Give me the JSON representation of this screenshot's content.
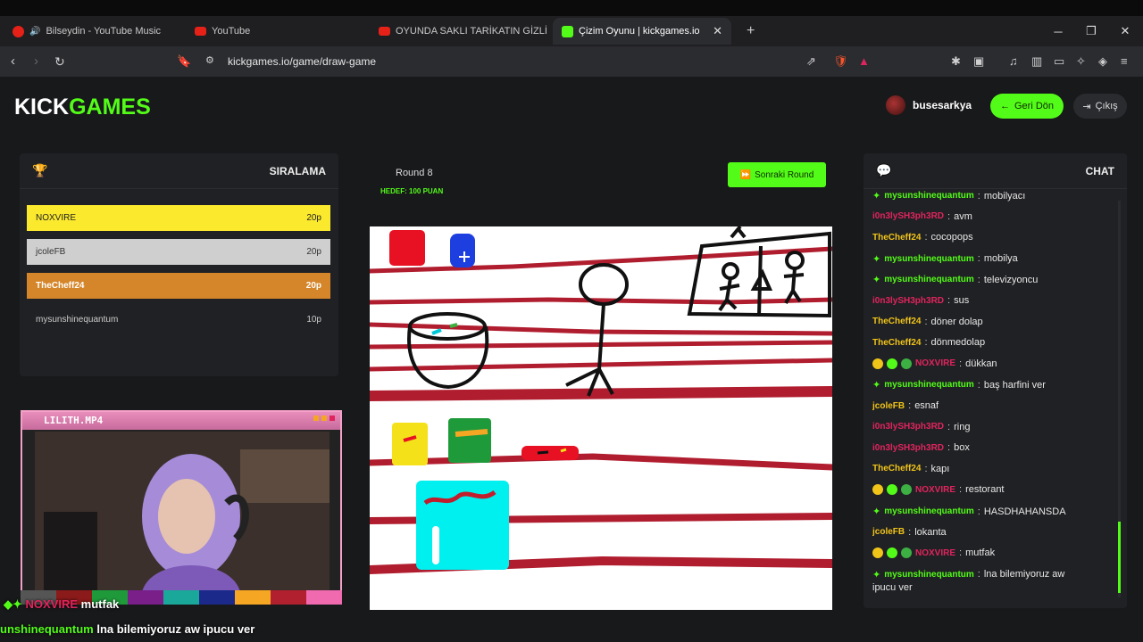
{
  "browser": {
    "tabs": [
      {
        "label": "Bilseydin - YouTube Music",
        "icon": "youtube-music-icon"
      },
      {
        "label": "YouTube",
        "icon": "youtube-icon"
      },
      {
        "label": "OYUNDA SAKLI TARİKATIN GİZLİ SIRI",
        "icon": "youtube-icon"
      },
      {
        "label": "Çizim Oyunu | kickgames.io",
        "icon": "kickgames-icon",
        "active": true
      }
    ],
    "url": "kickgames.io/game/draw-game"
  },
  "site": {
    "logo_part1": "KICK",
    "logo_part2": "GAMES",
    "username": "busesarkya",
    "back_label": "Geri Dön",
    "logout_label": "Çıkış"
  },
  "ranking": {
    "title": "SIRALAMA",
    "rows": [
      {
        "name": "NOXVIRE",
        "score": "20p"
      },
      {
        "name": "jcoleFB",
        "score": "20p"
      },
      {
        "name": "TheCheff24",
        "score": "20p"
      },
      {
        "name": "mysunshinequantum",
        "score": "10p"
      }
    ]
  },
  "game": {
    "round": "Round 8",
    "target": "HEDEF: 100 PUAN",
    "next_round_label": "Sonraki Round"
  },
  "chat": {
    "title": "CHAT",
    "messages": [
      {
        "user": "mysunshinequantum",
        "text": "mobilyacı",
        "color": "#53fc18",
        "badge": "diamond"
      },
      {
        "user": "i0n3lySH3ph3RD",
        "text": "avm",
        "color": "#e0245e",
        "badge": ""
      },
      {
        "user": "TheCheff24",
        "text": "cocopops",
        "color": "#f0c419",
        "badge": ""
      },
      {
        "user": "mysunshinequantum",
        "text": "mobilya",
        "color": "#53fc18",
        "badge": "diamond"
      },
      {
        "user": "mysunshinequantum",
        "text": "televizyoncu",
        "color": "#53fc18",
        "badge": "diamond"
      },
      {
        "user": "i0n3lySH3ph3RD",
        "text": "sus",
        "color": "#e0245e",
        "badge": ""
      },
      {
        "user": "TheCheff24",
        "text": "döner dolap",
        "color": "#f0c419",
        "badge": ""
      },
      {
        "user": "TheCheff24",
        "text": "dönmedolap",
        "color": "#f0c419",
        "badge": ""
      },
      {
        "user": "NOXVIRE",
        "text": "dükkan",
        "color": "#e0245e",
        "badge": "multi"
      },
      {
        "user": "mysunshinequantum",
        "text": "baş harfini ver",
        "color": "#53fc18",
        "badge": "diamond"
      },
      {
        "user": "jcoleFB",
        "text": "esnaf",
        "color": "#f0c419",
        "badge": ""
      },
      {
        "user": "i0n3lySH3ph3RD",
        "text": "ring",
        "color": "#e0245e",
        "badge": ""
      },
      {
        "user": "i0n3lySH3ph3RD",
        "text": "box",
        "color": "#e0245e",
        "badge": ""
      },
      {
        "user": "TheCheff24",
        "text": "kapı",
        "color": "#f0c419",
        "badge": ""
      },
      {
        "user": "NOXVIRE",
        "text": "restorant",
        "color": "#e0245e",
        "badge": "multi"
      },
      {
        "user": "mysunshinequantum",
        "text": "HASDHAHANSDA",
        "color": "#53fc18",
        "badge": "diamond"
      },
      {
        "user": "jcoleFB",
        "text": "lokanta",
        "color": "#f0c419",
        "badge": ""
      },
      {
        "user": "NOXVIRE",
        "text": "mutfak",
        "color": "#e0245e",
        "badge": "multi"
      },
      {
        "user": "mysunshinequantum",
        "text": "lna bilemiyoruz aw",
        "color": "#53fc18",
        "badge": "diamond"
      }
    ],
    "last_line_continuation": "ipucu ver"
  },
  "webcam": {
    "title": "LILITH.MP4"
  },
  "stream_overlay": {
    "line1_user": "NOXVIRE",
    "line1_text": "mutfak",
    "line2_user": "unshinequantum",
    "line2_text": "lna bilemiyoruz aw ipucu ver"
  }
}
